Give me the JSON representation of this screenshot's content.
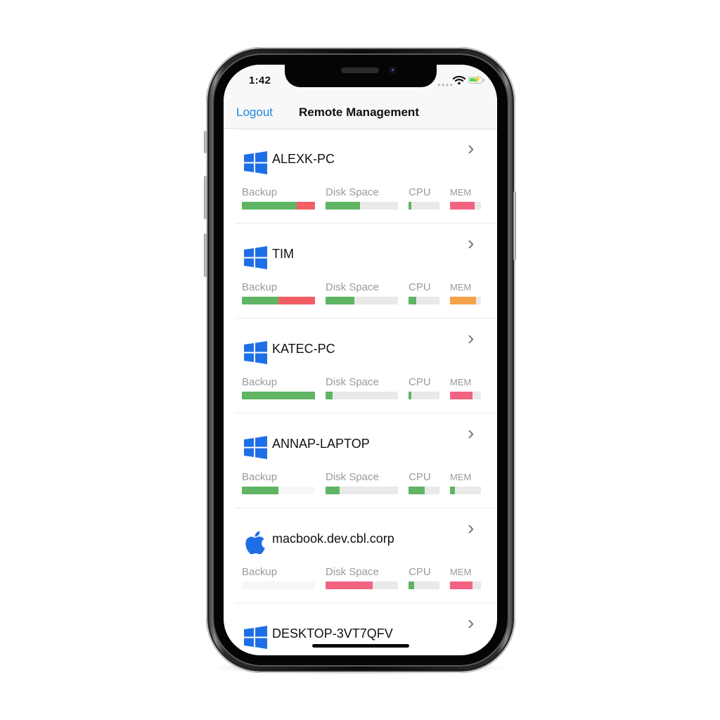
{
  "status_bar": {
    "time": "1:42",
    "signal_icon": "signal-dots-icon",
    "wifi_icon": "wifi-icon",
    "battery_icon": "battery-charging-icon"
  },
  "nav": {
    "logout_label": "Logout",
    "title": "Remote Management"
  },
  "colors": {
    "accent": "#1e88e5",
    "ok": "#5fb564",
    "error": "#f15f65",
    "warning": "#f7a04a",
    "critical": "#f26382",
    "track": "#e9e9e9",
    "os_icon": "#1e6fe6"
  },
  "metric_labels": {
    "backup": "Backup",
    "disk": "Disk Space",
    "cpu": "CPU",
    "mem": "MEM"
  },
  "devices": [
    {
      "name": "ALEXK-PC",
      "os": "windows",
      "backup": [
        {
          "value": 75,
          "color": "#5fb564"
        },
        {
          "value": 25,
          "color": "#f15f65"
        }
      ],
      "disk": {
        "value": 48,
        "color": "#5fb564"
      },
      "cpu": {
        "value": 8,
        "color": "#5fb564"
      },
      "mem": {
        "value": 80,
        "color": "#f26382"
      }
    },
    {
      "name": "TIM",
      "os": "windows",
      "backup": [
        {
          "value": 50,
          "color": "#5fb564"
        },
        {
          "value": 50,
          "color": "#f15f65"
        }
      ],
      "disk": {
        "value": 40,
        "color": "#5fb564"
      },
      "cpu": {
        "value": 25,
        "color": "#5fb564"
      },
      "mem": {
        "value": 85,
        "color": "#f7a04a"
      }
    },
    {
      "name": "KATEC-PC",
      "os": "windows",
      "backup": [
        {
          "value": 100,
          "color": "#5fb564"
        }
      ],
      "disk": {
        "value": 10,
        "color": "#5fb564"
      },
      "cpu": {
        "value": 8,
        "color": "#5fb564"
      },
      "mem": {
        "value": 72,
        "color": "#f26382"
      }
    },
    {
      "name": "ANNAP-LAPTOP",
      "os": "windows",
      "backup_track": "light",
      "backup": [
        {
          "value": 50,
          "color": "#5fb564"
        }
      ],
      "disk": {
        "value": 19,
        "color": "#5fb564"
      },
      "cpu": {
        "value": 52,
        "color": "#5fb564"
      },
      "mem": {
        "value": 16,
        "color": "#5fb564"
      }
    },
    {
      "name": "macbook.dev.cbl.corp",
      "os": "apple",
      "backup_track": "light",
      "backup": [],
      "disk": {
        "value": 65,
        "color": "#f26382"
      },
      "cpu": {
        "value": 18,
        "color": "#5fb564"
      },
      "mem": {
        "value": 72,
        "color": "#f26382"
      }
    },
    {
      "name": "DESKTOP-3VT7QFV",
      "os": "windows",
      "backup": [],
      "disk": null,
      "cpu": null,
      "mem": null
    }
  ]
}
